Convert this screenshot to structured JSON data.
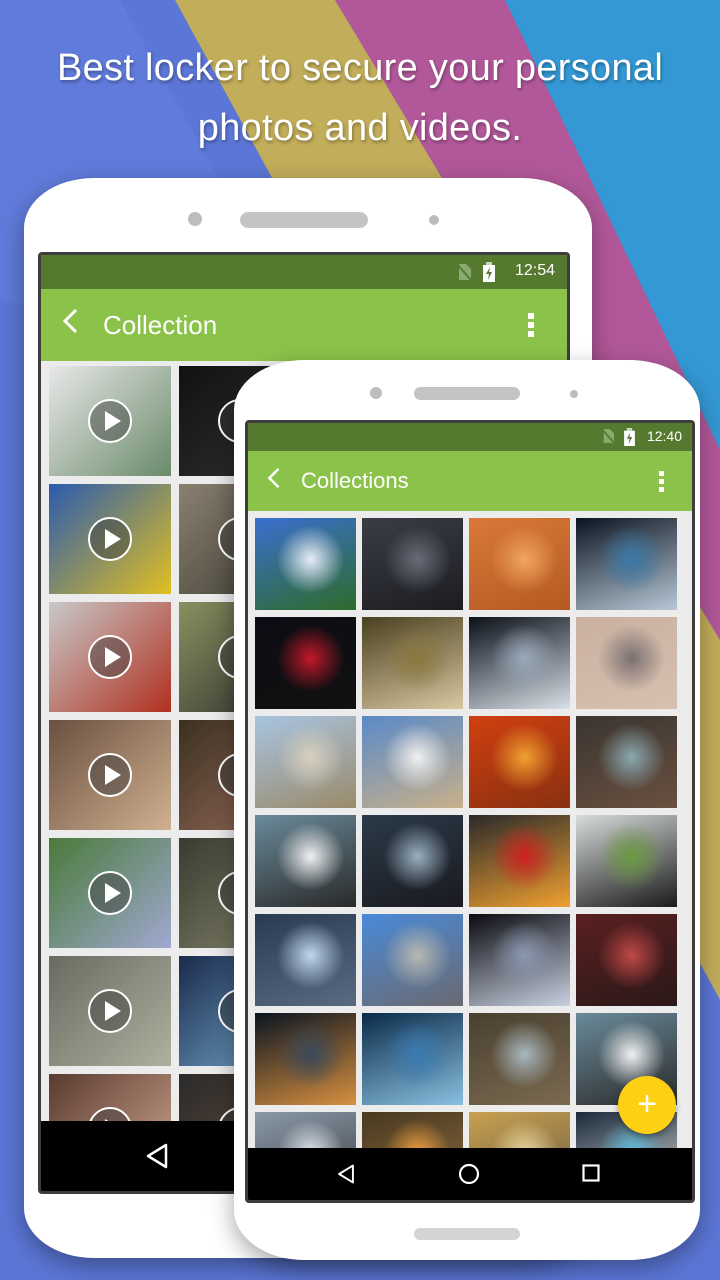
{
  "headline": {
    "line1": "Best locker to secure your personal",
    "line2": "photos and videos."
  },
  "back_phone": {
    "status_time": "12:54",
    "status_icons": [
      "no-sim-icon",
      "battery-charging-icon"
    ],
    "title": "Collection",
    "back_icon": "chevron-left-icon",
    "menu_icon": "more-vert-icon",
    "tiles": [
      {
        "kind": "video",
        "desc": "sketch icons"
      },
      {
        "kind": "video",
        "desc": "dark text screen"
      },
      {
        "kind": "video",
        "desc": "minions"
      },
      {
        "kind": "video",
        "desc": "soldier with rifle"
      },
      {
        "kind": "video",
        "desc": "man in jacket red wall"
      },
      {
        "kind": "video",
        "desc": "man in forest"
      },
      {
        "kind": "video",
        "desc": "couple close-up"
      },
      {
        "kind": "video",
        "desc": "man face close-up"
      },
      {
        "kind": "video",
        "desc": "field with flowers"
      },
      {
        "kind": "video",
        "desc": "man in suit"
      },
      {
        "kind": "video",
        "desc": "man in rain"
      },
      {
        "kind": "video",
        "desc": "window blue light"
      },
      {
        "kind": "video",
        "desc": "eyes close-up"
      },
      {
        "kind": "video",
        "desc": "dark scene"
      }
    ],
    "nav": [
      "back-icon"
    ]
  },
  "front_phone": {
    "status_time": "12:40",
    "status_icons": [
      "no-sim-icon",
      "battery-charging-icon"
    ],
    "title": "Collections",
    "back_icon": "chevron-left-icon",
    "menu_icon": "more-vert-icon",
    "fab_label": "+",
    "tiles": [
      {
        "desc": "shuttle launch",
        "colors": [
          "#3b6fd0",
          "#e8eef8",
          "#2e6b2a"
        ]
      },
      {
        "desc": "observatory night sky",
        "colors": [
          "#3a3d45",
          "#6a6d78",
          "#1c1d22"
        ]
      },
      {
        "desc": "orange sandstone waves",
        "colors": [
          "#d9793a",
          "#f0a560",
          "#b45a22"
        ]
      },
      {
        "desc": "earth from orbit",
        "colors": [
          "#0a1420",
          "#3a78a8",
          "#b8c8d6"
        ]
      },
      {
        "desc": "red nebula",
        "colors": [
          "#0c0c14",
          "#c2182a",
          "#111111"
        ]
      },
      {
        "desc": "still life wine glass",
        "colors": [
          "#4a4020",
          "#8a7840",
          "#d8c8a0"
        ]
      },
      {
        "desc": "space station over earth",
        "colors": [
          "#0a0f18",
          "#9aaabb",
          "#d8e0e8"
        ]
      },
      {
        "desc": "desert satellite terrain",
        "colors": [
          "#c9b0a0",
          "#7a7070",
          "#d8c0b0"
        ]
      },
      {
        "desc": "radio telescope desert",
        "colors": [
          "#a8c4e0",
          "#d8d0c0",
          "#9a8a6a"
        ]
      },
      {
        "desc": "radio dish clouds",
        "colors": [
          "#5a8ac8",
          "#f0f0f0",
          "#c8b08a"
        ]
      },
      {
        "desc": "fire dragon",
        "colors": [
          "#d04010",
          "#f0a030",
          "#8a3010"
        ]
      },
      {
        "desc": "robot fight",
        "colors": [
          "#3a3530",
          "#8aa8b0",
          "#6a5040"
        ]
      },
      {
        "desc": "white bmw",
        "colors": [
          "#6a8a9a",
          "#f0f0f0",
          "#2a2a2a"
        ]
      },
      {
        "desc": "classic car tail lights",
        "colors": [
          "#2a3a48",
          "#9ab0c0",
          "#1a1a20"
        ]
      },
      {
        "desc": "red phoenix",
        "colors": [
          "#2a2a2a",
          "#d02020",
          "#f0a030"
        ]
      },
      {
        "desc": "helicopter on grass",
        "colors": [
          "#d8dcdc",
          "#6a9a40",
          "#1a1a1a"
        ]
      },
      {
        "desc": "sci-fi machinery",
        "colors": [
          "#2a3a50",
          "#c0d8f0",
          "#5a6a80"
        ]
      },
      {
        "desc": "fighter jet on runway",
        "colors": [
          "#4a8ad8",
          "#b8b8b0",
          "#6a6a70"
        ]
      },
      {
        "desc": "earth surface curve",
        "colors": [
          "#0a0a10",
          "#8a98b0",
          "#c8d0e0"
        ]
      },
      {
        "desc": "red galaxy",
        "colors": [
          "#5a2020",
          "#c04848",
          "#2a1818"
        ]
      },
      {
        "desc": "exploding planet",
        "colors": [
          "#0a1420",
          "#3a4a5a",
          "#d89040"
        ]
      },
      {
        "desc": "blue abstract",
        "colors": [
          "#0a2a4a",
          "#3a7ab0",
          "#8ac0e0"
        ]
      },
      {
        "desc": "robot fight 2",
        "colors": [
          "#4a4030",
          "#a8b8c0",
          "#7a6a50"
        ]
      },
      {
        "desc": "white bmw 2",
        "colors": [
          "#6a8a9a",
          "#f0f0f0",
          "#2a2a2a"
        ]
      },
      {
        "desc": "snowy car",
        "colors": [
          "#8a9aa8",
          "#e0e8f0",
          "#3a3a40"
        ]
      },
      {
        "desc": "explosion scene",
        "colors": [
          "#4a3a20",
          "#f0a040",
          "#8a6a40"
        ]
      },
      {
        "desc": "desert vehicle",
        "colors": [
          "#c8a050",
          "#e8d8a0",
          "#6a5a40"
        ]
      },
      {
        "desc": "beach family",
        "colors": [
          "#1a2a3a",
          "#60c0e0",
          "#e0e0e0"
        ]
      }
    ],
    "nav": [
      "back-icon",
      "home-icon",
      "recents-icon"
    ]
  },
  "colors": {
    "statusbar": "#557a2f",
    "appbar": "#8bc34a",
    "fab": "#fdd014",
    "bg_blue": "#5b76d6",
    "bg_yellow": "#c2ad5a",
    "bg_magenta": "#b2589a",
    "bg_cyan": "#3398d4"
  }
}
